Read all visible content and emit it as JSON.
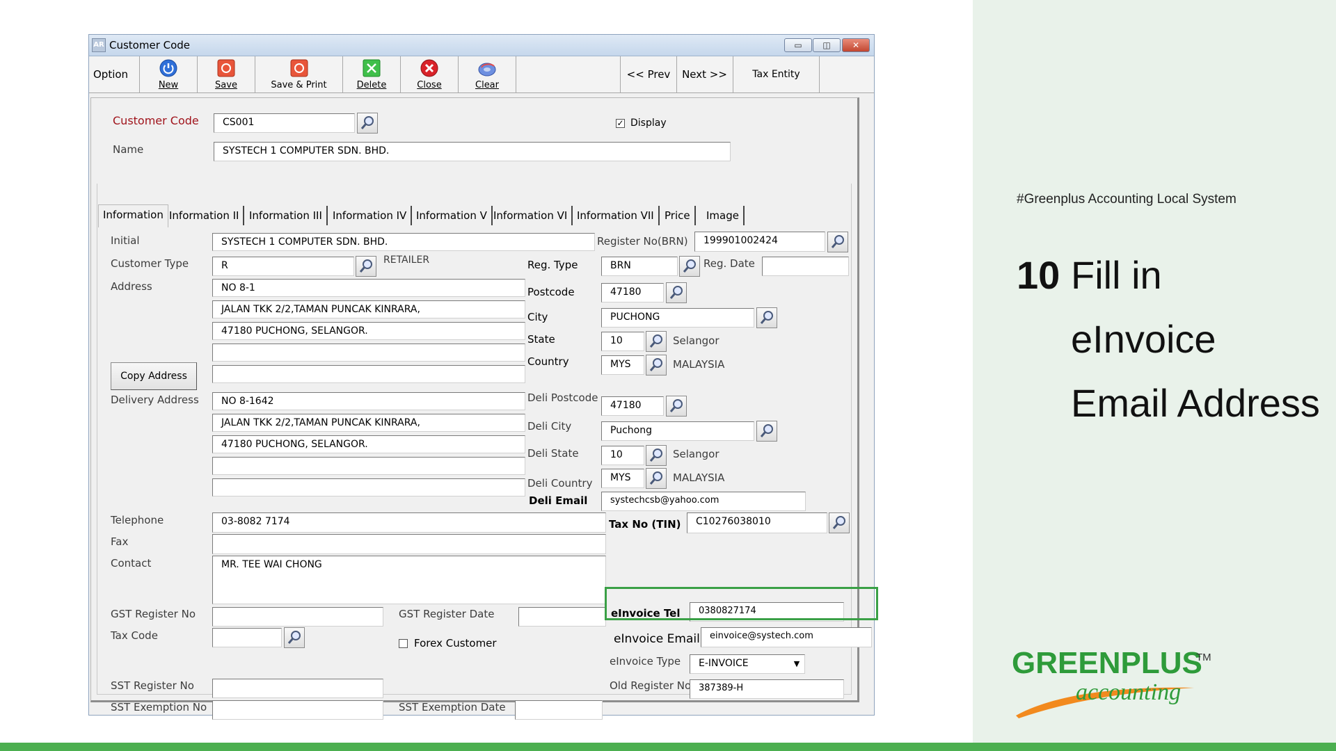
{
  "slide": {
    "hashtag": "#Greenplus Accounting Local System",
    "step_number": "10",
    "step_line1": "Fill in",
    "step_line2": "eInvoice",
    "step_line3": "Email Address",
    "logo_word1": "GREENPLUS",
    "logo_tm": "TM",
    "logo_word2": "accounting"
  },
  "window": {
    "app_icon": "AR",
    "title": "Customer Code"
  },
  "toolbar": {
    "option_label": "Option",
    "buttons": [
      "New",
      "Save",
      "Save & Print",
      "Delete",
      "Close",
      "Clear"
    ],
    "prev_label": "<<  Prev",
    "next_label": "Next  >>",
    "tax_entity_label": "Tax Entity"
  },
  "header": {
    "customer_code_label": "Customer Code",
    "customer_code_value": "CS001",
    "display_label": "Display",
    "display_checked": "✓",
    "name_label": "Name",
    "name_value": "SYSTECH 1 COMPUTER SDN. BHD."
  },
  "tabs": [
    "Information",
    "Information II",
    "Information III",
    "Information IV",
    "Information V",
    "Information VI",
    "Information VII",
    "Price",
    "Image"
  ],
  "info": {
    "initial_label": "Initial",
    "initial_value": "SYSTECH 1 COMPUTER SDN. BHD.",
    "register_no_label": "Register No(BRN)",
    "register_no_value": "199901002424",
    "customer_type_label": "Customer Type",
    "customer_type_value": "R",
    "customer_type_desc": "RETAILER",
    "reg_type_label": "Reg. Type",
    "reg_type_value": "BRN",
    "reg_date_label": "Reg. Date",
    "reg_date_value": "",
    "address_label": "Address",
    "address_lines": [
      "NO 8-1",
      "JALAN TKK 2/2,TAMAN PUNCAK KINRARA,",
      "47180 PUCHONG, SELANGOR.",
      "",
      ""
    ],
    "postcode_label": "Postcode",
    "postcode_value": "47180",
    "city_label": "City",
    "city_value": "PUCHONG",
    "state_label": "State",
    "state_value": "10",
    "state_desc": "Selangor",
    "country_label": "Country",
    "country_value": "MYS",
    "country_desc": "MALAYSIA",
    "copy_address_label": "Copy Address",
    "delivery_label": "Delivery Address",
    "delivery_lines": [
      "NO 8-1642",
      "JALAN TKK 2/2,TAMAN PUNCAK KINRARA,",
      "47180 PUCHONG, SELANGOR.",
      "",
      ""
    ],
    "deli_postcode_label": "Deli Postcode",
    "deli_postcode_value": "47180",
    "deli_city_label": "Deli City",
    "deli_city_value": "Puchong",
    "deli_state_label": "Deli State",
    "deli_state_value": "10",
    "deli_state_desc": "Selangor",
    "deli_country_label": "Deli Country",
    "deli_country_value": "MYS",
    "deli_country_desc": "MALAYSIA",
    "deli_email_label": "Deli Email",
    "deli_email_value": "systechcsb@yahoo.com",
    "telephone_label": "Telephone",
    "telephone_value": "03-8082 7174",
    "tax_no_label": "Tax No (TIN)",
    "tax_no_value": "C10276038010",
    "fax_label": "Fax",
    "fax_value": "",
    "contact_label": "Contact",
    "contact_value": "MR. TEE WAI CHONG",
    "gst_reg_no_label": "GST Register No",
    "gst_reg_date_label": "GST Register Date",
    "einvoice_tel_label": "eInvoice Tel",
    "einvoice_tel_value": "0380827174",
    "tax_code_label": "Tax Code",
    "forex_label": "Forex Customer",
    "einvoice_email_label": "eInvoice Email",
    "einvoice_email_value": "einvoice@systech.com",
    "einvoice_type_label": "eInvoice Type",
    "einvoice_type_value": "E-INVOICE",
    "sst_reg_no_label": "SST Register No",
    "old_reg_no_label": "Old Register No",
    "old_reg_no_value": "387389-H",
    "sst_exemption_no_label": "SST Exemption No",
    "sst_exemption_date_label": "SST Exemption Date"
  },
  "colors": {
    "highlight": "#3aa046",
    "brand_green": "#2e9b3a",
    "brand_orange": "#f28a1e"
  }
}
